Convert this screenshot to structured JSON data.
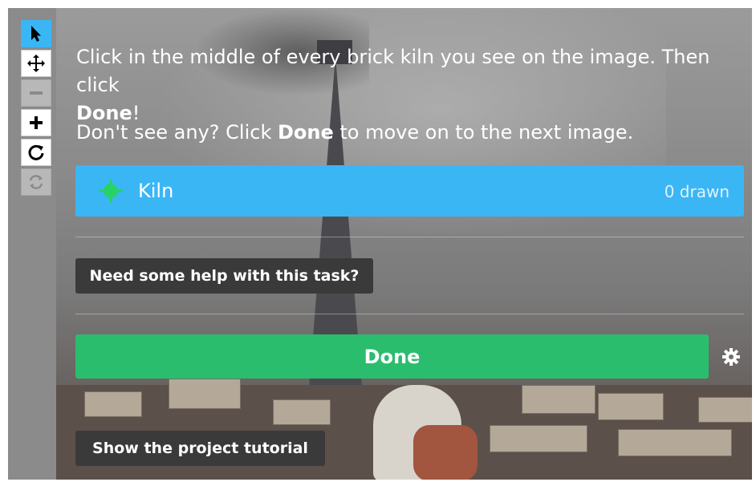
{
  "instructions": {
    "line1_prefix": "Click in the middle of every brick kiln you see on the image. Then click",
    "line1_bold": "Done",
    "line1_suffix": "!",
    "line2_prefix": "Don't see any? Click ",
    "line2_bold": "Done",
    "line2_suffix": " to move on to the next image."
  },
  "task": {
    "tool_label": "Kiln",
    "drawn_count": "0 drawn",
    "icon": "crosshair-point-icon"
  },
  "buttons": {
    "help": "Need some help with this task?",
    "done": "Done",
    "tutorial": "Show the project tutorial"
  },
  "toolbar": {
    "tools": [
      {
        "name": "pointer-icon",
        "active": true
      },
      {
        "name": "move-icon",
        "active": false
      },
      {
        "name": "zoom-out-icon",
        "disabled": true
      },
      {
        "name": "zoom-in-icon",
        "active": false
      },
      {
        "name": "rotate-icon",
        "active": false
      },
      {
        "name": "reset-icon",
        "disabled": true
      }
    ]
  },
  "colors": {
    "accent_blue": "#3bb6f5",
    "done_green": "#2bbd6e",
    "dark_button": "#3a3a3a",
    "kiln_icon_green": "#25d366"
  }
}
